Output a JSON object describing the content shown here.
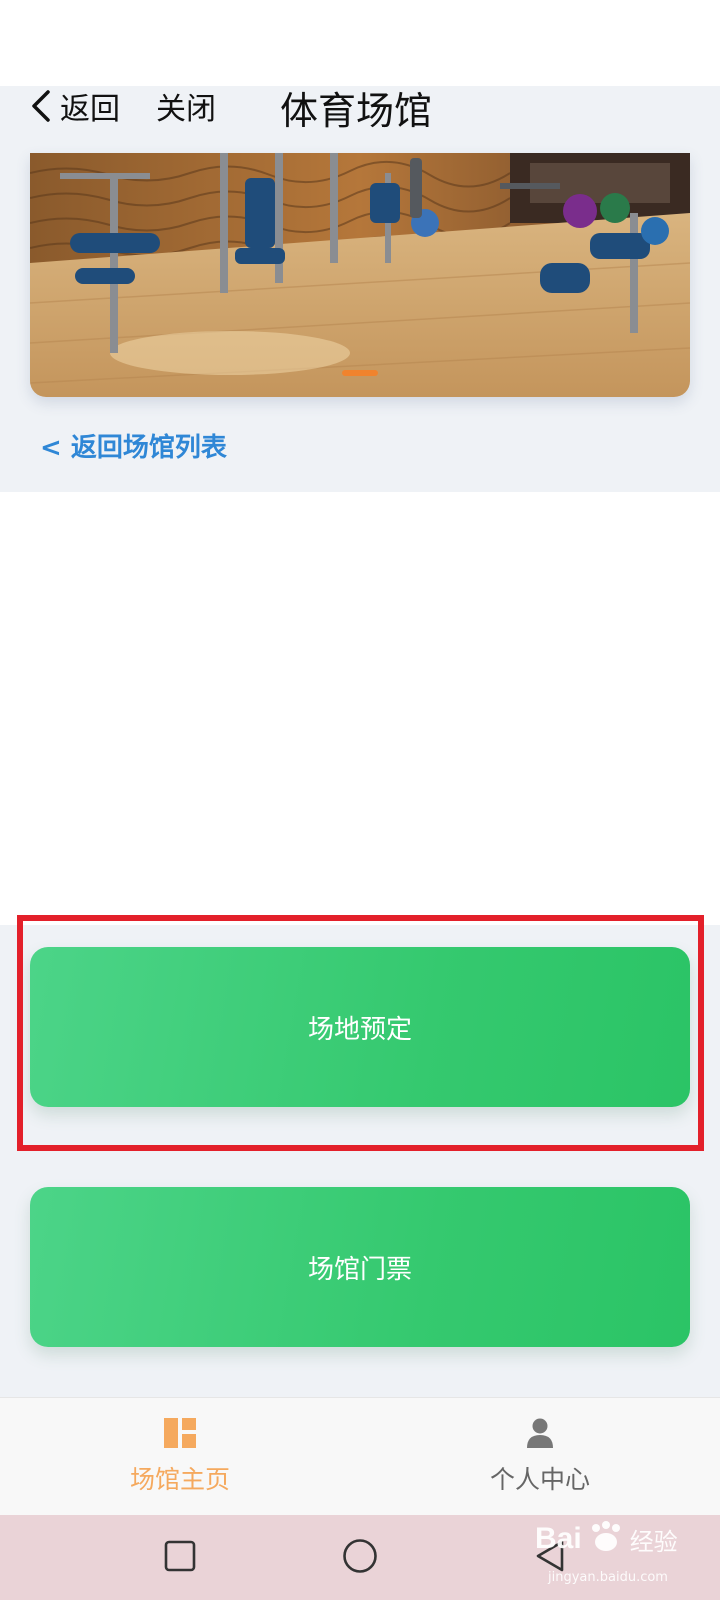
{
  "header": {
    "back_label": "返回",
    "close_label": "关闭",
    "title": "体育场馆"
  },
  "banner": {
    "description_icon": "gym-photo",
    "active_indicator_color": "#f0832d"
  },
  "links": {
    "back_to_list": "< 返回场馆列表"
  },
  "actions": {
    "venue_booking": "场地预定",
    "venue_tickets": "场馆门票"
  },
  "tabbar": {
    "home_label": "场馆主页",
    "profile_label": "个人中心",
    "active_color": "#f5a95e",
    "inactive_color": "#666666"
  },
  "watermark": {
    "brand": "Bai",
    "brand_suffix": "经验",
    "url": "jingyan.baidu.com"
  },
  "colors": {
    "button_green": "#35c96f",
    "highlight_red": "#e3202a",
    "link_blue": "#2f87d6"
  }
}
